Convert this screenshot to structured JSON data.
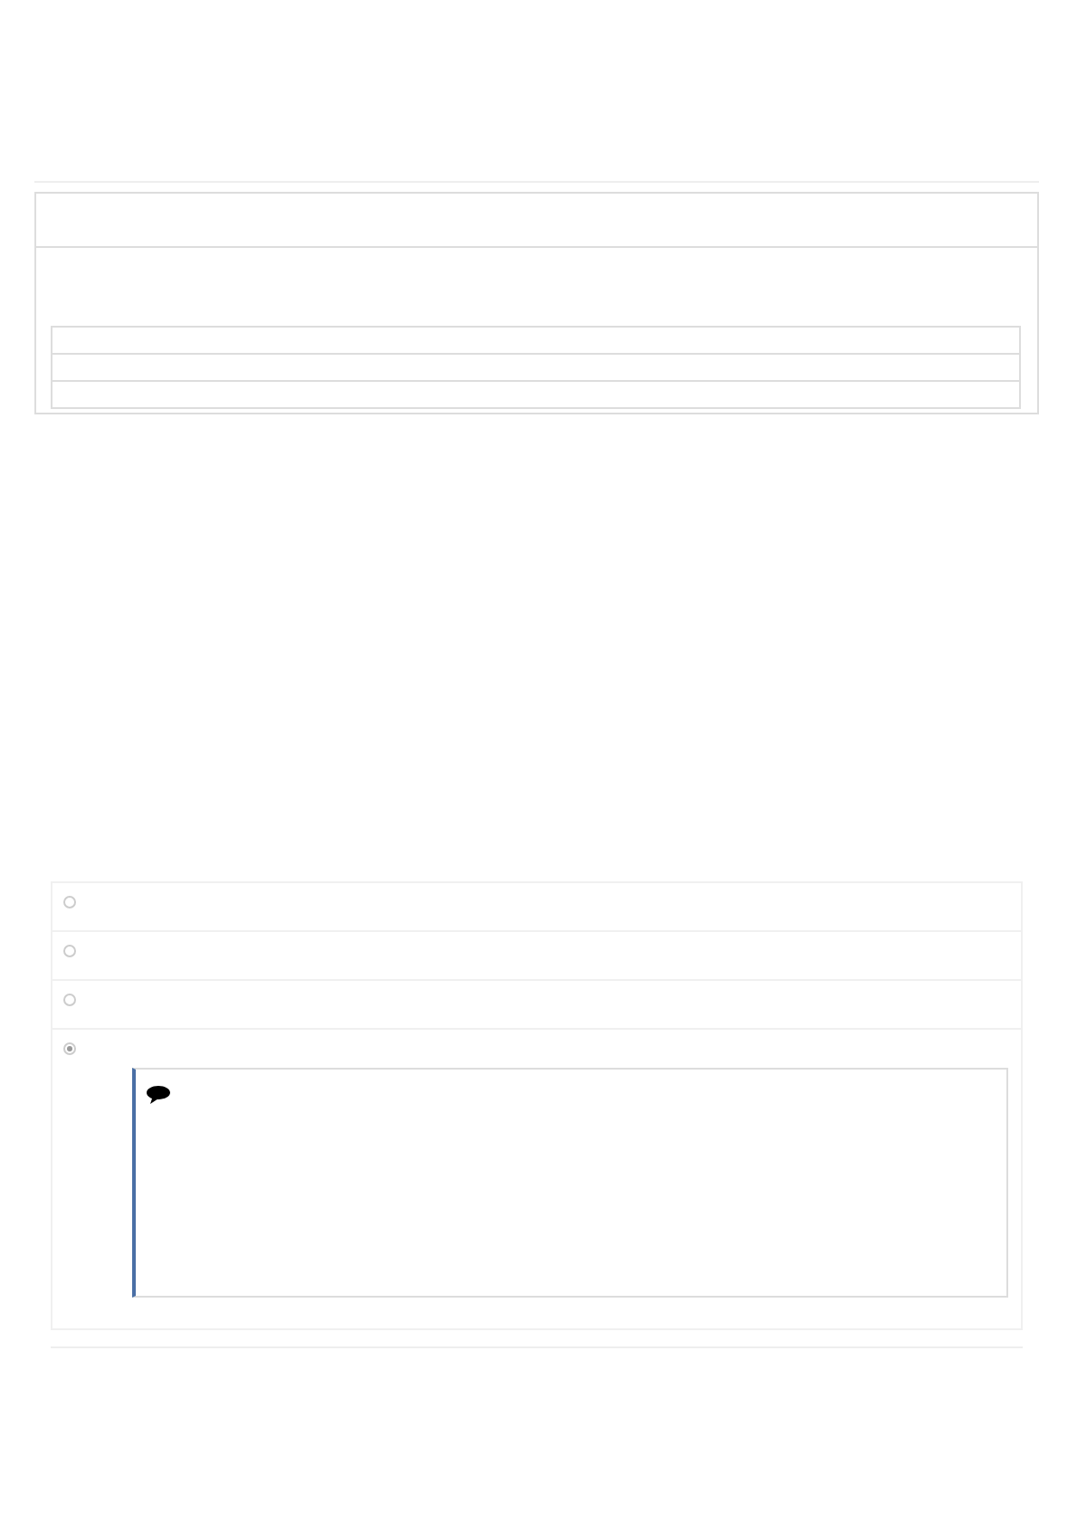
{
  "panel": {
    "table": {
      "rows": [
        {
          "kind": "empty"
        },
        {
          "kind": "empty"
        },
        {
          "kind": "empty"
        }
      ]
    }
  },
  "options": [
    {
      "selected": false
    },
    {
      "selected": false
    },
    {
      "selected": false
    },
    {
      "selected": true
    }
  ],
  "feedback": {
    "kind": "comment"
  }
}
